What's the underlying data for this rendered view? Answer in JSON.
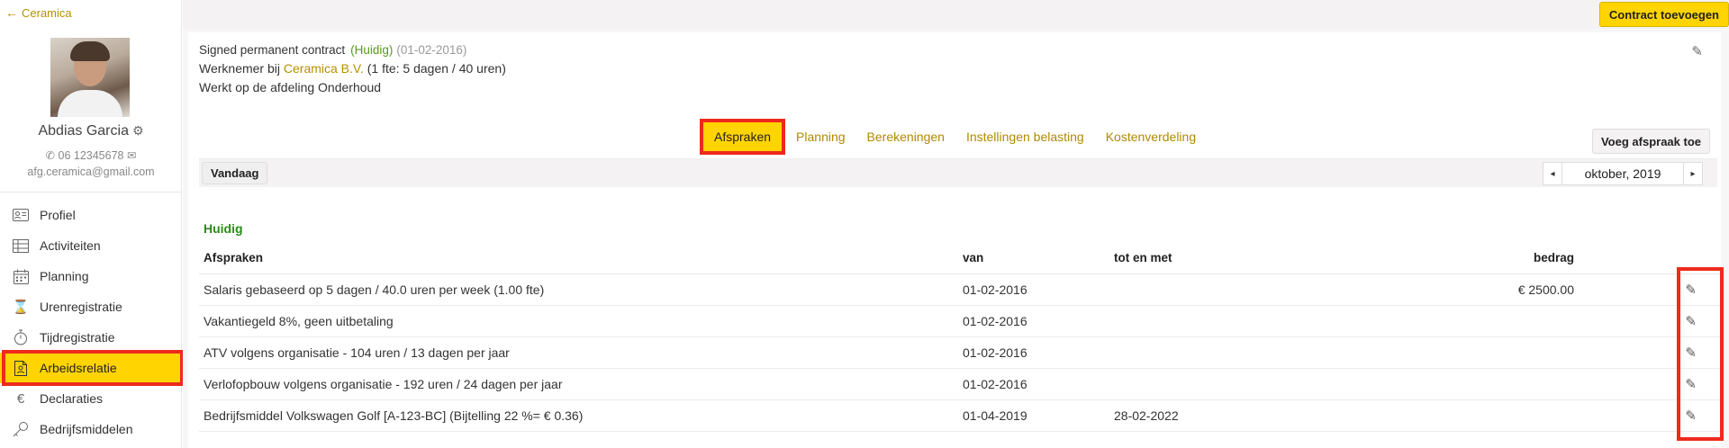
{
  "sidebar": {
    "back_label": "Ceramica",
    "user": {
      "name": "Abdias Garcia",
      "phone": "06 12345678",
      "email": "afg.ceramica@gmail.com"
    },
    "items": [
      {
        "label": "Profiel",
        "icon": "id-card-icon"
      },
      {
        "label": "Activiteiten",
        "icon": "table-icon"
      },
      {
        "label": "Planning",
        "icon": "calendar-icon"
      },
      {
        "label": "Urenregistratie",
        "icon": "hourglass-icon"
      },
      {
        "label": "Tijdregistratie",
        "icon": "stopwatch-icon"
      },
      {
        "label": "Arbeidsrelatie",
        "icon": "contract-file-icon",
        "active": true
      },
      {
        "label": "Declaraties",
        "icon": "euro-icon"
      },
      {
        "label": "Bedrijfsmiddelen",
        "icon": "key-icon"
      }
    ]
  },
  "header": {
    "add_contract_label": "Contract toevoegen"
  },
  "contract": {
    "title": "Signed permanent contract",
    "status": "(Huidig)",
    "date": "(01-02-2016)",
    "employer_prefix": "Werknemer bij",
    "company": "Ceramica B.V.",
    "fte_text": "(1 fte: 5 dagen / 40 uren)",
    "department_text": "Werkt op de afdeling Onderhoud"
  },
  "tabs": [
    {
      "label": "Afspraken",
      "active": true
    },
    {
      "label": "Planning"
    },
    {
      "label": "Berekeningen"
    },
    {
      "label": "Instellingen belasting"
    },
    {
      "label": "Kostenverdeling"
    }
  ],
  "actions": {
    "add_agreement_label": "Voeg afspraak toe",
    "today_label": "Vandaag",
    "month_label": "oktober, 2019",
    "prev_symbol": "◂",
    "next_symbol": "▸"
  },
  "section": {
    "title": "Huidig"
  },
  "table": {
    "headers": {
      "description": "Afspraken",
      "from": "van",
      "until": "tot en met",
      "amount": "bedrag"
    },
    "rows": [
      {
        "description": "Salaris gebaseerd op 5 dagen / 40.0 uren per week (1.00 fte)",
        "from": "01-02-2016",
        "until": "",
        "amount": "€ 2500.00"
      },
      {
        "description": "Vakantiegeld 8%, geen uitbetaling",
        "from": "01-02-2016",
        "until": "",
        "amount": ""
      },
      {
        "description": "ATV volgens organisatie - 104 uren / 13 dagen per jaar",
        "from": "01-02-2016",
        "until": "",
        "amount": ""
      },
      {
        "description": "Verlofopbouw volgens organisatie - 192 uren / 24 dagen per jaar",
        "from": "01-02-2016",
        "until": "",
        "amount": ""
      },
      {
        "description": "Bedrijfsmiddel Volkswagen Golf [A-123-BC] (Bijtelling 22 %= € 0.36)",
        "from": "01-04-2019",
        "until": "28-02-2022",
        "amount": ""
      }
    ]
  },
  "colors": {
    "accent_yellow": "#ffd400",
    "highlight_red": "#ee2a1c",
    "link_gold": "#b08a00",
    "status_green": "#2d8a1a"
  }
}
